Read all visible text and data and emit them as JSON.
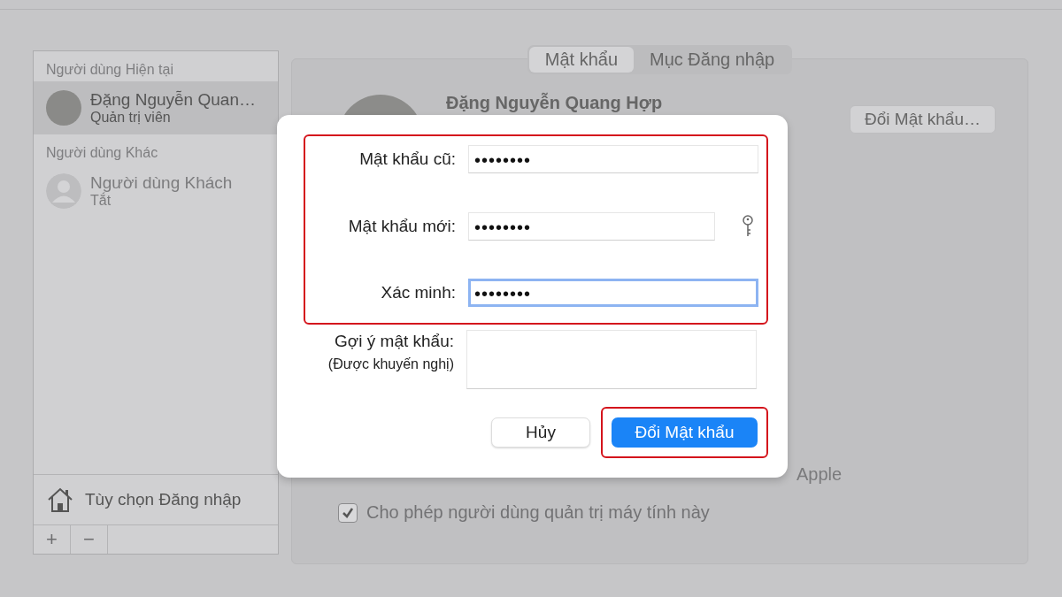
{
  "tabs": [
    {
      "label": "Mật khẩu",
      "selected": true
    },
    {
      "label": "Mục Đăng nhập",
      "selected": false
    }
  ],
  "sidebar": {
    "sections": [
      {
        "heading": "Người dùng Hiện tại",
        "users": [
          {
            "name": "Đặng Nguyễn Quan…",
            "role": "Quản trị viên",
            "selected": true,
            "disabled": false,
            "kind": "photo"
          }
        ]
      },
      {
        "heading": "Người dùng Khác",
        "users": [
          {
            "name": "Người dùng Khách",
            "role": "Tắt",
            "selected": false,
            "disabled": true,
            "kind": "guest"
          }
        ]
      }
    ],
    "login_options": "Tùy chọn Đăng nhập",
    "add_button": "+",
    "remove_button": "−"
  },
  "profile": {
    "name": "Đặng Nguyễn Quang Hợp",
    "change_password_button": "Đổi Mật khẩu…"
  },
  "covered_option_fragment": "Apple",
  "checkbox_option": {
    "label": "Cho phép người dùng quản trị máy tính này",
    "checked": true
  },
  "dialog": {
    "fields": [
      {
        "label": "Mật khẩu cũ:",
        "value": "••••••••",
        "focused": false,
        "kind": "password"
      },
      {
        "label": "Mật khẩu mới:",
        "value": "••••••••",
        "focused": false,
        "kind": "password_with_key"
      },
      {
        "label": "Xác minh:",
        "value": "••••••••",
        "focused": true,
        "kind": "password"
      }
    ],
    "hint": {
      "label": "Gợi ý mật khẩu:",
      "note": "(Được khuyến nghị)"
    },
    "cancel_button": "Hủy",
    "confirm_button": "Đổi Mật khẩu"
  }
}
